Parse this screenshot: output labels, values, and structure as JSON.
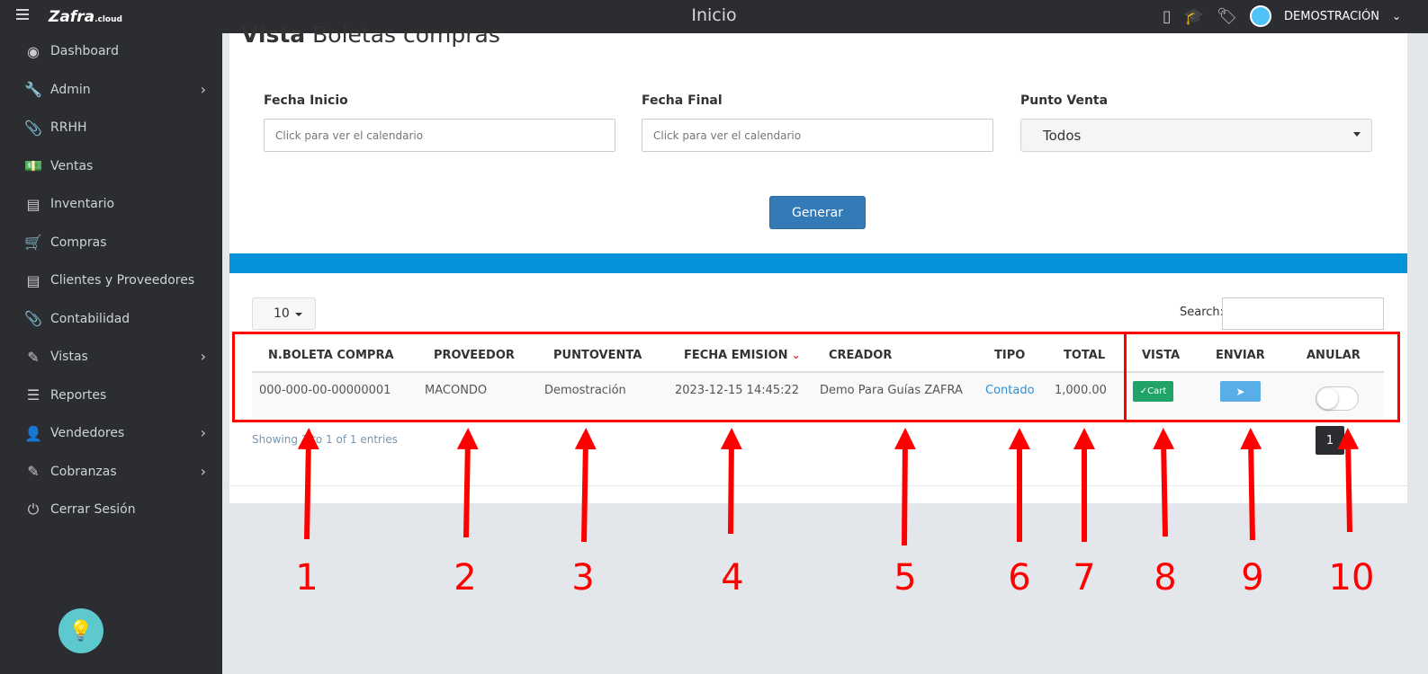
{
  "topbar": {
    "logo_text": "Zafra",
    "logo_suffix": ".cloud",
    "title": "Inicio",
    "user_name": "DEMOSTRACIÓN"
  },
  "sidebar": {
    "items": [
      {
        "label": "Dashboard",
        "icon": "palette-icon",
        "glyph": "◉",
        "has_submenu": false
      },
      {
        "label": "Admin",
        "icon": "wrench-icon",
        "glyph": "🔧",
        "has_submenu": true
      },
      {
        "label": "RRHH",
        "icon": "paperclip-icon",
        "glyph": "📎",
        "has_submenu": false
      },
      {
        "label": "Ventas",
        "icon": "money-icon",
        "glyph": "💵",
        "has_submenu": false
      },
      {
        "label": "Inventario",
        "icon": "book-icon",
        "glyph": "▤",
        "has_submenu": false
      },
      {
        "label": "Compras",
        "icon": "cart-icon",
        "glyph": "🛒",
        "has_submenu": false
      },
      {
        "label": "Clientes y Proveedores",
        "icon": "book-icon",
        "glyph": "▤",
        "has_submenu": false
      },
      {
        "label": "Contabilidad",
        "icon": "paperclip-icon",
        "glyph": "📎",
        "has_submenu": false
      },
      {
        "label": "Vistas",
        "icon": "edit-icon",
        "glyph": "✎",
        "has_submenu": true
      },
      {
        "label": "Reportes",
        "icon": "list-icon",
        "glyph": "☰",
        "has_submenu": false
      },
      {
        "label": "Vendedores",
        "icon": "user-icon",
        "glyph": "👤",
        "has_submenu": true
      },
      {
        "label": "Cobranzas",
        "icon": "edit-icon",
        "glyph": "✎",
        "has_submenu": true
      },
      {
        "label": "Cerrar Sesión",
        "icon": "power-icon",
        "glyph": "⏻",
        "has_submenu": false
      }
    ]
  },
  "page": {
    "title_bold": "Vista",
    "title_rest": "Boletas compras"
  },
  "filters": {
    "start_label": "Fecha Inicio",
    "start_placeholder": "Click para ver el calendario",
    "end_label": "Fecha Final",
    "end_placeholder": "Click para ver el calendario",
    "pos_label": "Punto Venta",
    "pos_value": "Todos",
    "generate_label": "Generar"
  },
  "table": {
    "length_value": "10",
    "search_label": "Search:",
    "columns": [
      "N.BOLETA COMPRA",
      "PROVEEDOR",
      "PUNTOVENTA",
      "FECHA EMISION",
      "CREADOR",
      "TIPO",
      "TOTAL",
      "VISTA",
      "ENVIAR",
      "ANULAR"
    ],
    "rows": [
      {
        "boleta": "000-000-00-00000001",
        "proveedor": "MACONDO",
        "puntoventa": "Demostración",
        "fecha": "2023-12-15 14:45:22",
        "creador": "Demo Para Guías ZAFRA",
        "tipo": "Contado",
        "total": "1,000.00",
        "vista_label": "Cart",
        "anular_on": false
      }
    ],
    "info": "Showing 1 to 1 of 1 entries",
    "page": "1"
  },
  "annotations": [
    "1",
    "2",
    "3",
    "4",
    "5",
    "6",
    "7",
    "8",
    "9",
    "10"
  ],
  "colors": {
    "accent_blue": "#0594d9",
    "button_blue": "#337ab7",
    "annotation_red": "#ff0000",
    "sidebar_bg": "#2b2d31"
  }
}
